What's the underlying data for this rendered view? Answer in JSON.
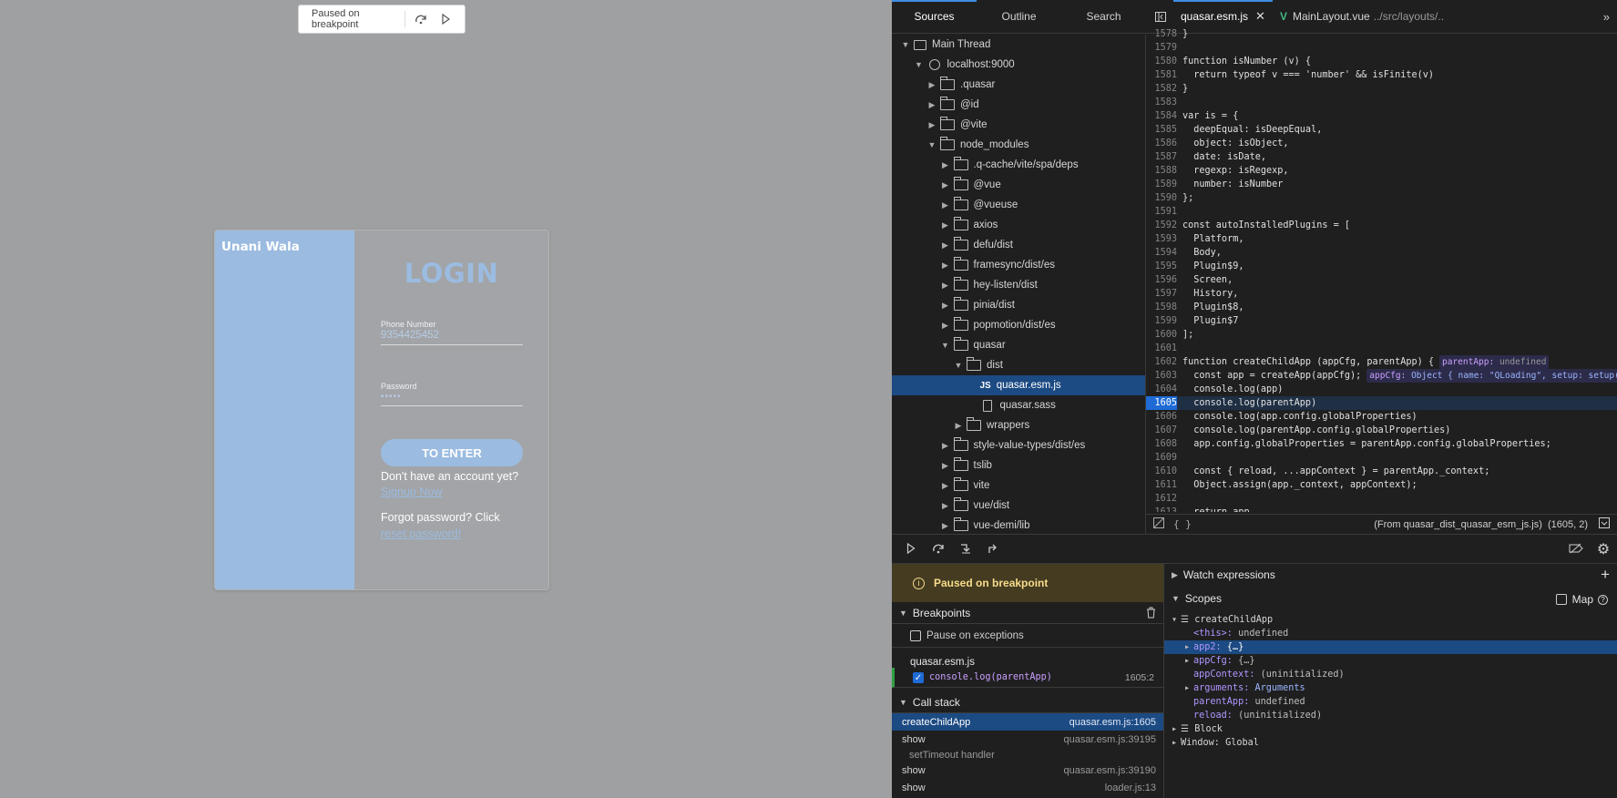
{
  "page": {
    "paused_pill": {
      "text": "Paused on breakpoint",
      "step_over_icon": "step-over-icon",
      "resume_icon": "resume-icon"
    },
    "login": {
      "brand": "Unani Wala",
      "title": "LOGIN",
      "phone_label": "Phone Number",
      "phone_value": "9354425452",
      "password_label": "Password",
      "password_value": "•••••",
      "enter_button": "TO ENTER",
      "no_account_text": "Don't have an account yet?",
      "signup_link": "Signup Now",
      "forgot_text": "Forgot password? Click",
      "reset_link": "reset password!"
    },
    "colors": {
      "page_bg": "#9ea0a2",
      "card_blue": "#9bbbe0"
    }
  },
  "devtools": {
    "side_tabs": [
      "Sources",
      "Outline",
      "Search"
    ],
    "tree": [
      {
        "label": "Main Thread",
        "depth": 0,
        "twisty": "open",
        "icon": "window-icon"
      },
      {
        "label": "localhost:9000",
        "depth": 1,
        "twisty": "open",
        "icon": "globe-icon"
      },
      {
        "label": ".quasar",
        "depth": 2,
        "twisty": "closed",
        "icon": "folder-icon"
      },
      {
        "label": "@id",
        "depth": 2,
        "twisty": "closed",
        "icon": "folder-icon"
      },
      {
        "label": "@vite",
        "depth": 2,
        "twisty": "closed",
        "icon": "folder-icon"
      },
      {
        "label": "node_modules",
        "depth": 2,
        "twisty": "open",
        "icon": "folder-icon"
      },
      {
        "label": ".q-cache/vite/spa/deps",
        "depth": 3,
        "twisty": "closed",
        "icon": "folder-icon"
      },
      {
        "label": "@vue",
        "depth": 3,
        "twisty": "closed",
        "icon": "folder-icon"
      },
      {
        "label": "@vueuse",
        "depth": 3,
        "twisty": "closed",
        "icon": "folder-icon"
      },
      {
        "label": "axios",
        "depth": 3,
        "twisty": "closed",
        "icon": "folder-icon"
      },
      {
        "label": "defu/dist",
        "depth": 3,
        "twisty": "closed",
        "icon": "folder-icon"
      },
      {
        "label": "framesync/dist/es",
        "depth": 3,
        "twisty": "closed",
        "icon": "folder-icon"
      },
      {
        "label": "hey-listen/dist",
        "depth": 3,
        "twisty": "closed",
        "icon": "folder-icon"
      },
      {
        "label": "pinia/dist",
        "depth": 3,
        "twisty": "closed",
        "icon": "folder-icon"
      },
      {
        "label": "popmotion/dist/es",
        "depth": 3,
        "twisty": "closed",
        "icon": "folder-icon"
      },
      {
        "label": "quasar",
        "depth": 3,
        "twisty": "open",
        "icon": "folder-icon"
      },
      {
        "label": "dist",
        "depth": 4,
        "twisty": "open",
        "icon": "folder-icon"
      },
      {
        "label": "quasar.esm.js",
        "depth": 5,
        "twisty": "none",
        "icon": "js-file-icon",
        "selected": true
      },
      {
        "label": "quasar.sass",
        "depth": 5,
        "twisty": "none",
        "icon": "file-icon"
      },
      {
        "label": "wrappers",
        "depth": 4,
        "twisty": "closed",
        "icon": "folder-icon"
      },
      {
        "label": "style-value-types/dist/es",
        "depth": 3,
        "twisty": "closed",
        "icon": "folder-icon"
      },
      {
        "label": "tslib",
        "depth": 3,
        "twisty": "closed",
        "icon": "folder-icon"
      },
      {
        "label": "vite",
        "depth": 3,
        "twisty": "closed",
        "icon": "folder-icon"
      },
      {
        "label": "vue/dist",
        "depth": 3,
        "twisty": "closed",
        "icon": "folder-icon"
      },
      {
        "label": "vue-demi/lib",
        "depth": 3,
        "twisty": "closed",
        "icon": "folder-icon"
      }
    ],
    "editor_tabs": [
      {
        "name": "quasar.esm.js",
        "active": true,
        "closable": true
      },
      {
        "name": "MainLayout.vue",
        "path": "../src/layouts/..",
        "active": false
      }
    ],
    "code_lines": [
      {
        "n": "1578",
        "t": "}"
      },
      {
        "n": "1579",
        "t": ""
      },
      {
        "n": "1580",
        "t": "function isNumber (v) {"
      },
      {
        "n": "1581",
        "t": "  return typeof v === 'number' && isFinite(v)"
      },
      {
        "n": "1582",
        "t": "}"
      },
      {
        "n": "1583",
        "t": ""
      },
      {
        "n": "1584",
        "t": "var is = {"
      },
      {
        "n": "1585",
        "t": "  deepEqual: isDeepEqual,"
      },
      {
        "n": "1586",
        "t": "  object: isObject,"
      },
      {
        "n": "1587",
        "t": "  date: isDate,"
      },
      {
        "n": "1588",
        "t": "  regexp: isRegexp,"
      },
      {
        "n": "1589",
        "t": "  number: isNumber"
      },
      {
        "n": "1590",
        "t": "};"
      },
      {
        "n": "1591",
        "t": ""
      },
      {
        "n": "1592",
        "t": "const autoInstalledPlugins = ["
      },
      {
        "n": "1593",
        "t": "  Platform,"
      },
      {
        "n": "1594",
        "t": "  Body,"
      },
      {
        "n": "1595",
        "t": "  Plugin$9,"
      },
      {
        "n": "1596",
        "t": "  Screen,"
      },
      {
        "n": "1597",
        "t": "  History,"
      },
      {
        "n": "1598",
        "t": "  Plugin$8,"
      },
      {
        "n": "1599",
        "t": "  Plugin$7"
      },
      {
        "n": "1600",
        "t": "];"
      },
      {
        "n": "1601",
        "t": ""
      },
      {
        "n": "1602",
        "t": "function createChildApp (appCfg, parentApp) {",
        "inline": {
          "name": "parentApp:",
          "value": "undefined"
        }
      },
      {
        "n": "1603",
        "t": "  const app = createApp(appCfg);",
        "inline": {
          "name": "appCfg:",
          "value": "Object { name: \"QLoading\", setup: setup() }"
        }
      },
      {
        "n": "1604",
        "t": "  console.log(app)"
      },
      {
        "n": "1605",
        "t": "  console.log(parentApp)",
        "breakpoint": true
      },
      {
        "n": "1606",
        "t": "  console.log(app.config.globalProperties)"
      },
      {
        "n": "1607",
        "t": "  console.log(parentApp.config.globalProperties)"
      },
      {
        "n": "1608",
        "t": "  app.config.globalProperties = parentApp.config.globalProperties;"
      },
      {
        "n": "1609",
        "t": ""
      },
      {
        "n": "1610",
        "t": "  const { reload, ...appContext } = parentApp._context;"
      },
      {
        "n": "1611",
        "t": "  Object.assign(app._context, appContext);"
      },
      {
        "n": "1612",
        "t": ""
      },
      {
        "n": "1613",
        "t": "  return app"
      }
    ],
    "editor_status": {
      "format_icon": "{ }",
      "location": "(From quasar_dist_quasar_esm_js.js)  (1605, 2)"
    },
    "debug_buttons": [
      "resume-icon",
      "step-over-icon",
      "step-in-icon",
      "step-out-icon"
    ],
    "paused_banner": "Paused on breakpoint",
    "breakpoints": {
      "title": "Breakpoints",
      "pause_on_exceptions": "Pause on exceptions",
      "file": "quasar.esm.js",
      "entry_code": "console.log(parentApp)",
      "entry_line": "1605:2"
    },
    "call_stack": {
      "title": "Call stack",
      "frames": [
        {
          "name": "createChildApp",
          "src": "quasar.esm.js:1605",
          "selected": true
        },
        {
          "name": "show",
          "src": "quasar.esm.js:39195"
        },
        {
          "name": "setTimeout handler",
          "src": "",
          "group": true
        },
        {
          "name": "show",
          "src": "quasar.esm.js:39190"
        },
        {
          "name": "show",
          "src": "loader.js:13"
        }
      ]
    },
    "watch_title": "Watch expressions",
    "scopes": {
      "title": "Scopes",
      "map_label": "Map",
      "rows": [
        {
          "text": "☰ createChildApp",
          "indent": 0,
          "twisty": "▾"
        },
        {
          "key": "<this>:",
          "val": "undefined",
          "indent": 1,
          "twisty": ""
        },
        {
          "key": "app2:",
          "val": "{…}",
          "indent": 1,
          "twisty": "▸",
          "selected": true
        },
        {
          "key": "appCfg:",
          "val": "{…}",
          "indent": 1,
          "twisty": "▸"
        },
        {
          "key": "appContext:",
          "val": "(uninitialized)",
          "indent": 1,
          "twisty": ""
        },
        {
          "key": "arguments:",
          "val": "Arguments",
          "indent": 1,
          "twisty": "▸",
          "valClass": "fn"
        },
        {
          "key": "parentApp:",
          "val": "undefined",
          "indent": 1,
          "twisty": ""
        },
        {
          "key": "reload:",
          "val": "(uninitialized)",
          "indent": 1,
          "twisty": ""
        },
        {
          "text": "☰ Block",
          "indent": 0,
          "twisty": "▸"
        },
        {
          "text": "Window: Global",
          "indent": 0,
          "twisty": "▸"
        }
      ]
    }
  }
}
